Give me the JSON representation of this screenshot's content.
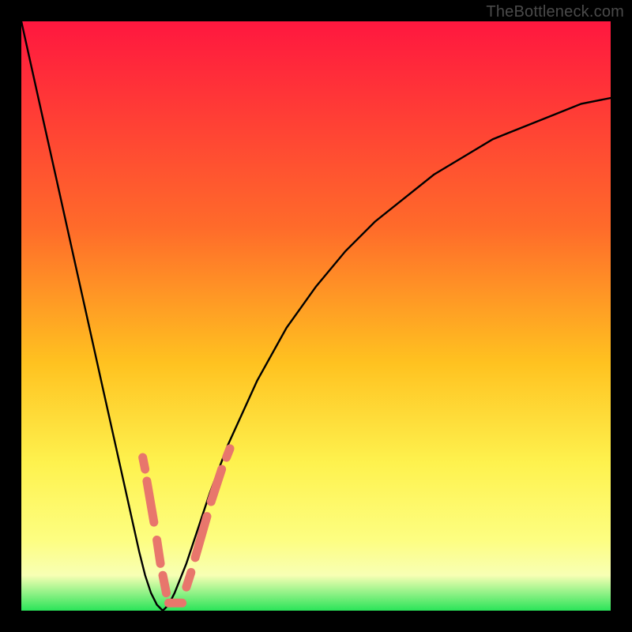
{
  "watermark": "TheBottleneck.com",
  "colors": {
    "frame": "#000000",
    "curve": "#000000",
    "dash": "#E8766C",
    "grad_top": "#FF173F",
    "grad_mid1": "#FF6B2A",
    "grad_mid2": "#FFC220",
    "grad_mid3": "#FEF24E",
    "grad_mid4": "#FDFE81",
    "grad_band": "#F8FFB4",
    "grad_bottom": "#2AE459"
  },
  "chart_data": {
    "type": "line",
    "title": "",
    "xlabel": "",
    "ylabel": "",
    "xlim": [
      0,
      100
    ],
    "ylim": [
      0,
      100
    ],
    "series": [
      {
        "name": "bottleneck-curve",
        "x": [
          0,
          2,
          4,
          6,
          8,
          10,
          12,
          14,
          16,
          18,
          20,
          21,
          22,
          23,
          24,
          25,
          26,
          28,
          30,
          32,
          35,
          40,
          45,
          50,
          55,
          60,
          65,
          70,
          75,
          80,
          85,
          90,
          95,
          100
        ],
        "y": [
          100,
          91,
          82,
          73,
          64,
          55,
          46,
          37,
          28,
          19,
          10,
          6,
          3,
          1,
          0,
          1,
          3,
          8,
          14,
          20,
          28,
          39,
          48,
          55,
          61,
          66,
          70,
          74,
          77,
          80,
          82,
          84,
          86,
          87
        ]
      }
    ],
    "dash_segments": {
      "left": [
        {
          "x0": 20.6,
          "y0": 26.0,
          "x1": 21.0,
          "y1": 24.0
        },
        {
          "x0": 21.3,
          "y0": 22.0,
          "x1": 22.5,
          "y1": 15.0
        },
        {
          "x0": 23.0,
          "y0": 12.0,
          "x1": 23.6,
          "y1": 8.0
        },
        {
          "x0": 24.0,
          "y0": 6.0,
          "x1": 24.6,
          "y1": 3.0
        }
      ],
      "right": [
        {
          "x0": 28.0,
          "y0": 4.0,
          "x1": 28.8,
          "y1": 6.5
        },
        {
          "x0": 29.5,
          "y0": 9.0,
          "x1": 31.5,
          "y1": 16.0
        },
        {
          "x0": 32.2,
          "y0": 18.5,
          "x1": 34.0,
          "y1": 24.0
        },
        {
          "x0": 34.8,
          "y0": 26.0,
          "x1": 35.4,
          "y1": 27.5
        }
      ],
      "bottom": [
        {
          "x0": 25.0,
          "y0": 1.3,
          "x1": 27.3,
          "y1": 1.3
        }
      ]
    },
    "gradient_stops": [
      {
        "pct": 0,
        "key": "grad_top"
      },
      {
        "pct": 35,
        "key": "grad_mid1"
      },
      {
        "pct": 58,
        "key": "grad_mid2"
      },
      {
        "pct": 75,
        "key": "grad_mid3"
      },
      {
        "pct": 88,
        "key": "grad_mid4"
      },
      {
        "pct": 94,
        "key": "grad_band"
      },
      {
        "pct": 100,
        "key": "grad_bottom"
      }
    ]
  }
}
